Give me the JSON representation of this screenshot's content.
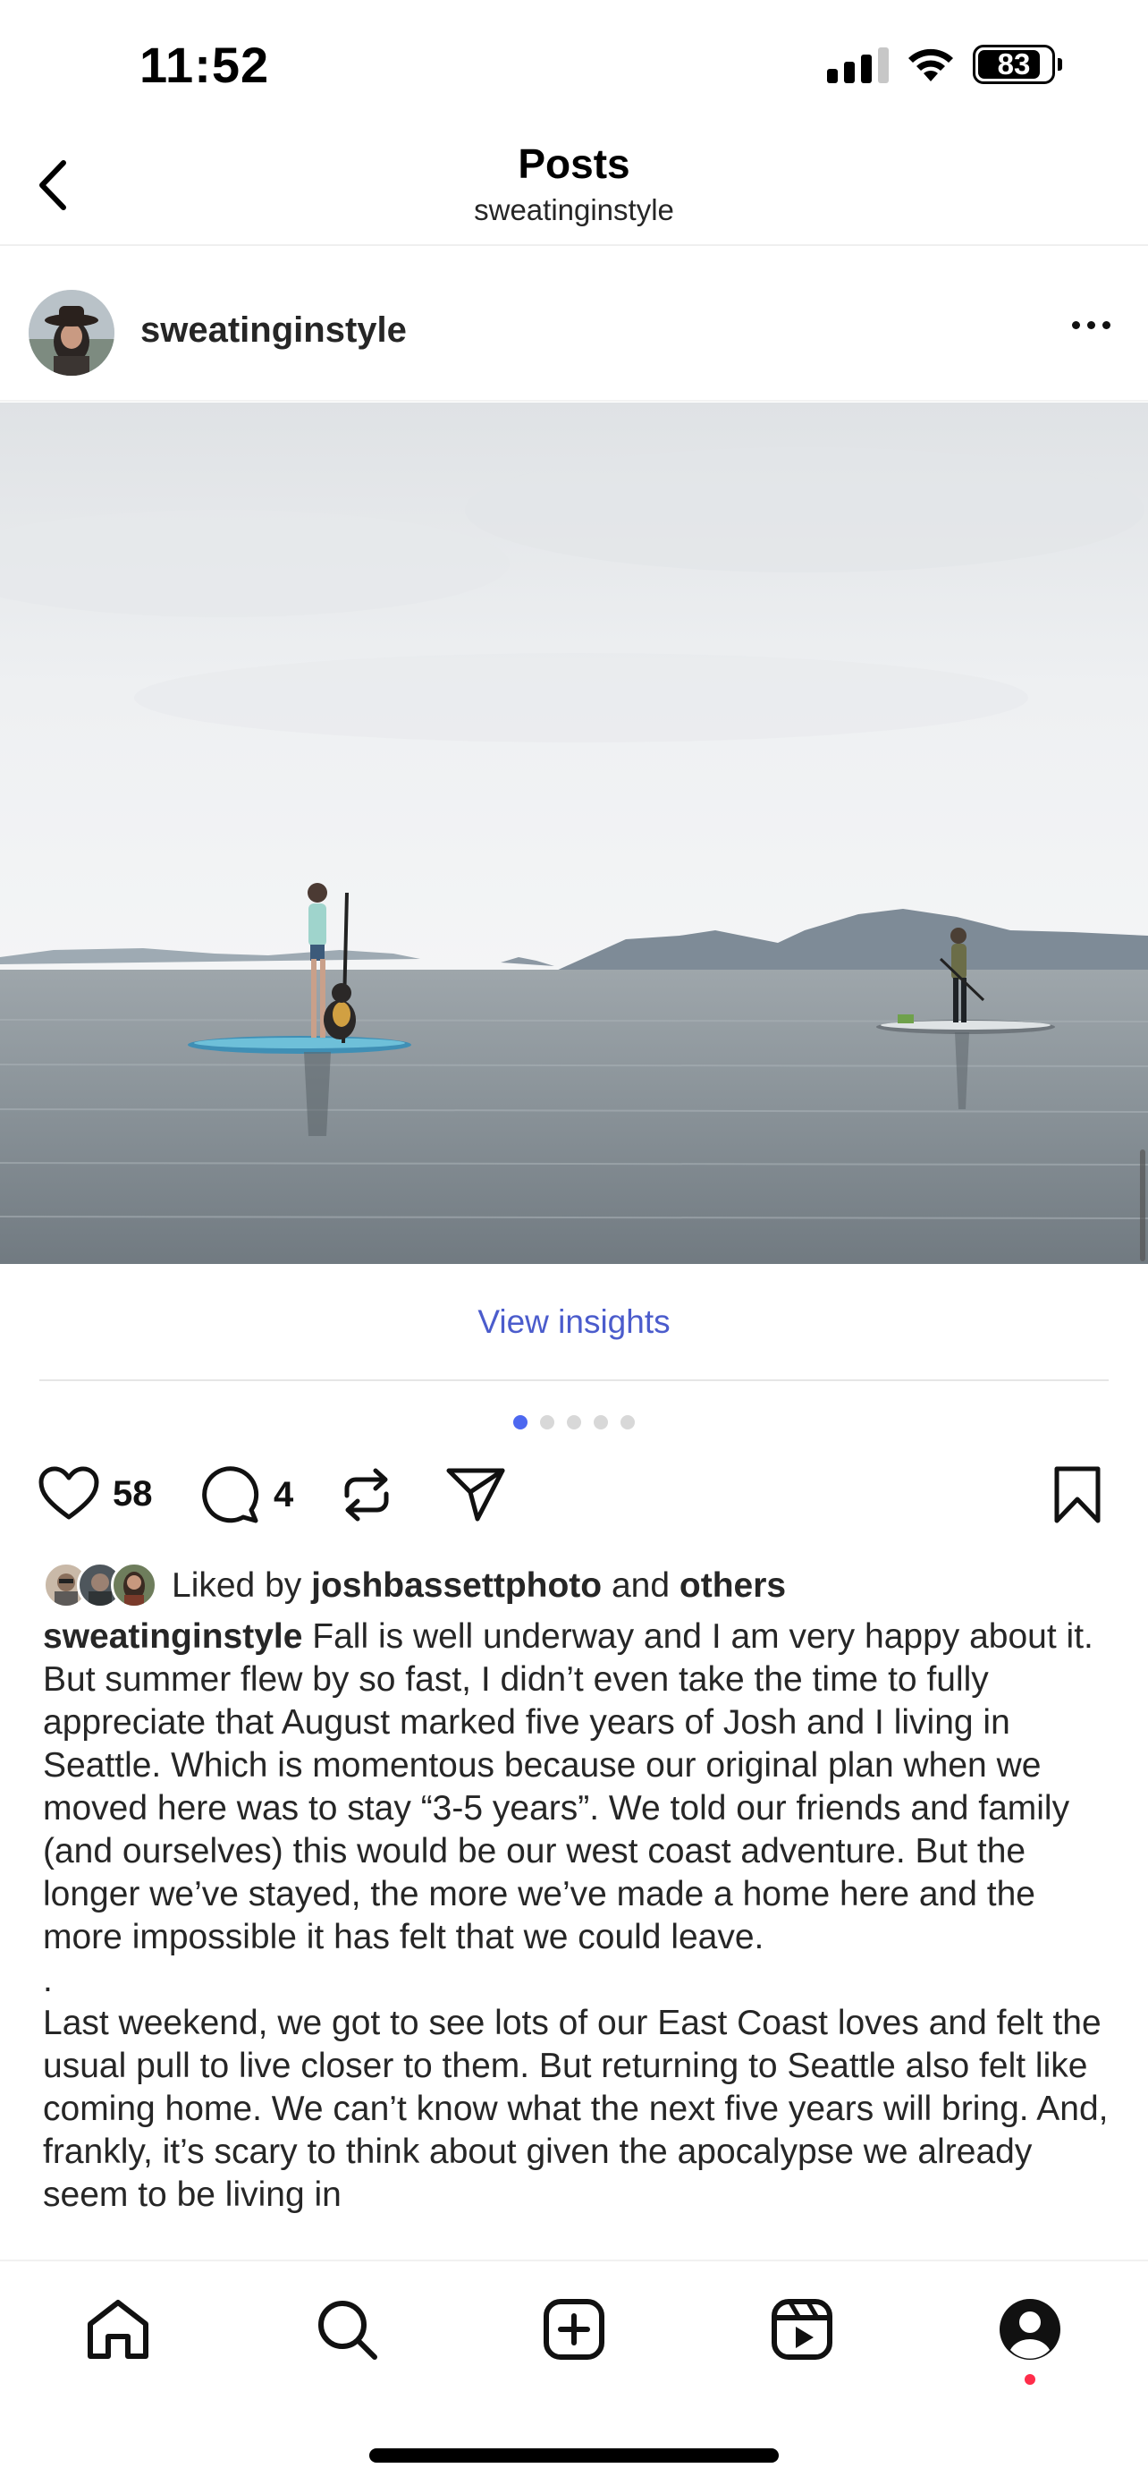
{
  "status_bar": {
    "time": "11:52",
    "battery": "83",
    "signal_icon": "cellular-signal-icon",
    "wifi_icon": "wifi-icon"
  },
  "nav": {
    "title": "Posts",
    "subtitle": "sweatinginstyle",
    "back_icon": "chevron-left-icon"
  },
  "post": {
    "username": "sweatinginstyle",
    "more_icon": "more-horizontal-icon",
    "image_icon": "post-photo",
    "view_insights": "View insights",
    "carousel": {
      "total": 5,
      "active": 1
    },
    "likes_count": "58",
    "comments_count": "4",
    "liked_by": {
      "prefix": "Liked by",
      "user": "joshbassettphoto",
      "middle": "and",
      "others": "others"
    },
    "caption": {
      "username": "sweatinginstyle",
      "paragraph1": "Fall is well underway and I am very happy about it. But summer flew by so fast, I didn’t even take the time to fully appreciate that August marked five years of Josh and I living in Seattle. Which is momentous because our original plan when we moved here was to stay “3-5 years”. We told our friends and family (and ourselves) this would be our west coast adventure. But the longer we’ve stayed, the more we’ve made a home here and the more impossible it has felt that we could leave.",
      "separator": ".",
      "paragraph2": "Last weekend, we got to see lots of our East Coast loves and felt the usual pull to live closer to them. But returning to Seattle also felt like coming home. We can’t know what the next five years will bring. And, frankly, it’s scary to think about given the apocalypse we already seem to be living in"
    }
  },
  "tabs": [
    {
      "name": "home-icon"
    },
    {
      "name": "search-icon"
    },
    {
      "name": "create-post-icon"
    },
    {
      "name": "reels-icon"
    },
    {
      "name": "profile-icon"
    }
  ],
  "colors": {
    "link": "#4b5ccc",
    "active_dot": "#4d68f0",
    "notification": "#ff2d4a"
  }
}
